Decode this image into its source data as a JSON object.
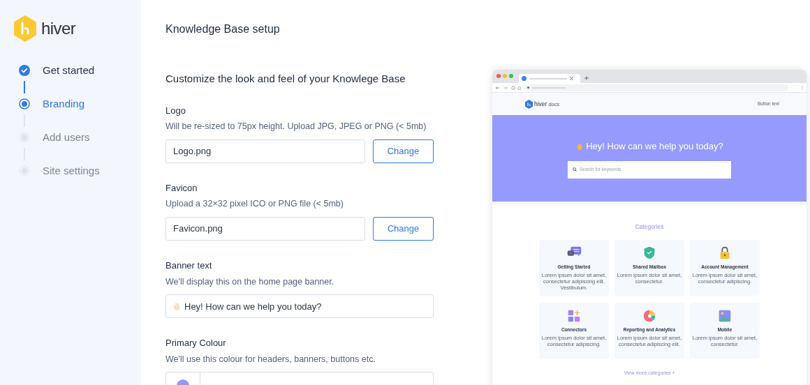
{
  "brand": {
    "name": "hiver"
  },
  "steps": [
    {
      "label": "Get started",
      "kind": "done"
    },
    {
      "label": "Branding",
      "kind": "current"
    },
    {
      "label": "Add users",
      "kind": "pending"
    },
    {
      "label": "Site settings",
      "kind": "pending"
    }
  ],
  "page_title": "Knowledge Base setup",
  "section_title": "Customize the look and feel of your Knowlege Base",
  "fields": [
    {
      "kind": "upload",
      "label": "Logo",
      "hint": "Will be re-sized to 75px height. Upload JPG, JPEG or PNG (< 5mb)",
      "value": "Logo.png",
      "button": "Change"
    },
    {
      "kind": "upload",
      "label": "Favicon",
      "hint": "Upload a 32×32 pixel ICO or PNG file (< 5mb)",
      "value": "Favicon.png",
      "button": "Change"
    },
    {
      "kind": "text",
      "label": "Banner text",
      "hint": "We'll display this on the home page banner.",
      "value": "Hey! How can we help you today?"
    },
    {
      "kind": "color",
      "label": "Primary Colour",
      "hint": "We'll use this colour for headers, banners, buttons etc."
    }
  ],
  "preview": {
    "brand": "hiver",
    "brand_suffix": "docs",
    "header_button": "Button text",
    "banner_title": "Hey! How can we help you today?",
    "search_placeholder": "Search for keywords",
    "categories_title": "Categories",
    "categories": [
      {
        "kind": "chat",
        "title": "Getting Started",
        "text": "Lorem ipsum dolor sit amet, consectetur adipiscing elit. Vestibulum."
      },
      {
        "kind": "shield",
        "title": "Shared Mailbox",
        "text": "Lorem ipsum dolor sit amet, consectetur."
      },
      {
        "kind": "lock",
        "title": "Account Management",
        "text": "Lorem ipsum dolor sit amet, consectetur adipiscing."
      },
      {
        "kind": "blocks",
        "title": "Connectors",
        "text": "Lorem ipsum dolor sit amet, consectetur adipiscing."
      },
      {
        "kind": "donut",
        "title": "Reporting and Analytics",
        "text": "Lorem ipsum dolor sit amet, consectetur adipiscing elit."
      },
      {
        "kind": "image",
        "title": "Mobile",
        "text": "Lorem ipsum dolor sit amet, consectetur."
      }
    ],
    "more_link": "View more categories +"
  }
}
